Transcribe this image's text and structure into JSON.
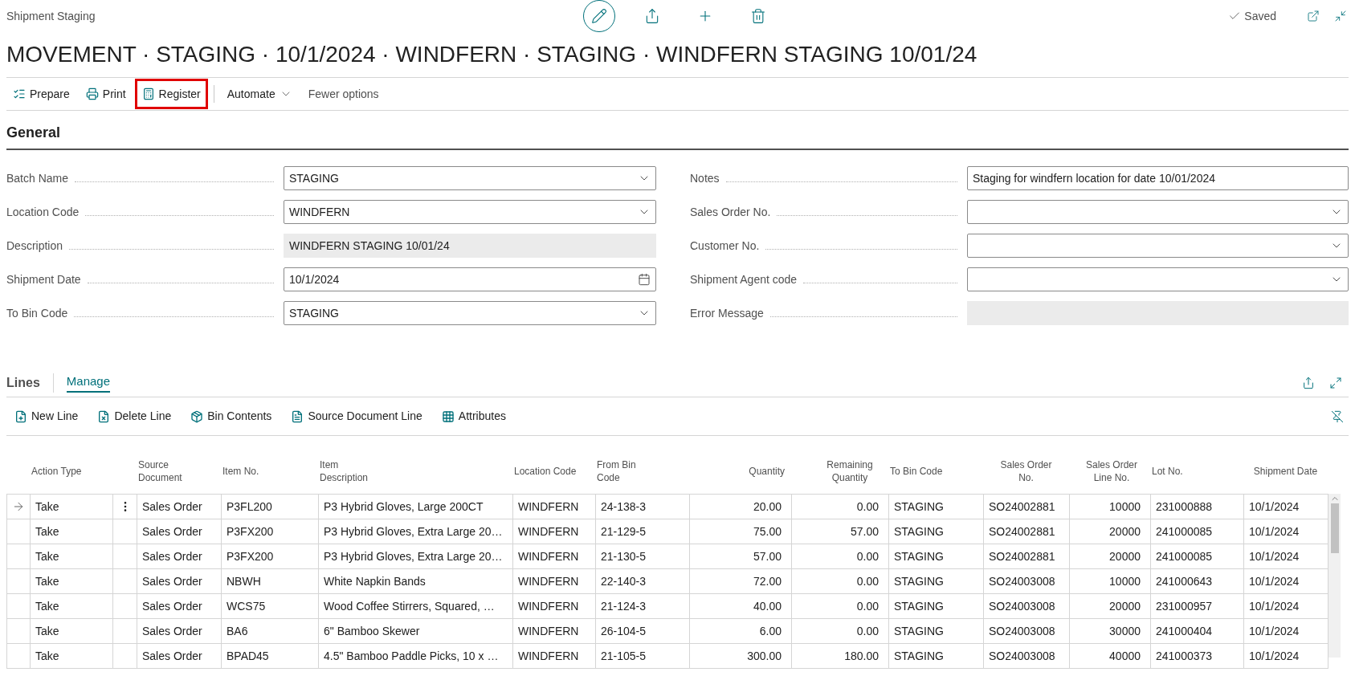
{
  "header": {
    "page_name": "Shipment Staging",
    "status": "Saved",
    "title": "MOVEMENT · STAGING · 10/1/2024 · WINDFERN · STAGING · WINDFERN STAGING 10/01/24"
  },
  "actions": [
    {
      "label": "Prepare",
      "kind": "prepare",
      "highlighted": false
    },
    {
      "label": "Print",
      "kind": "print",
      "highlighted": false
    },
    {
      "label": "Register",
      "kind": "register",
      "highlighted": true
    },
    {
      "label": "Automate",
      "kind": "menu",
      "highlighted": false
    },
    {
      "label": "Fewer options",
      "kind": "plain",
      "highlighted": false
    }
  ],
  "general": {
    "title": "General",
    "left_fields": [
      {
        "label": "Batch Name",
        "value": "STAGING",
        "kind": "dropdown"
      },
      {
        "label": "Location Code",
        "value": "WINDFERN",
        "kind": "dropdown"
      },
      {
        "label": "Description",
        "value": "WINDFERN STAGING 10/01/24",
        "kind": "readonly"
      },
      {
        "label": "Shipment Date",
        "value": "10/1/2024",
        "kind": "date"
      },
      {
        "label": "To Bin Code",
        "value": "STAGING",
        "kind": "dropdown"
      }
    ],
    "right_fields": [
      {
        "label": "Notes",
        "value": "Staging for windfern location for date 10/01/2024",
        "kind": "text"
      },
      {
        "label": "Sales Order No.",
        "kind": "dropdown"
      },
      {
        "label": "Customer No.",
        "kind": "dropdown"
      },
      {
        "label": "Shipment Agent code",
        "kind": "dropdown"
      },
      {
        "label": "Error Message",
        "kind": "readonly"
      }
    ]
  },
  "lines": {
    "title": "Lines",
    "tabs": [
      {
        "label": "Manage",
        "selected": true
      }
    ],
    "actions": [
      {
        "label": "New Line",
        "kind": "new"
      },
      {
        "label": "Delete Line",
        "kind": "delete"
      },
      {
        "label": "Bin Contents",
        "kind": "bin"
      },
      {
        "label": "Source Document Line",
        "kind": "document"
      },
      {
        "label": "Attributes",
        "kind": "grid"
      }
    ],
    "table": {
      "columns": [
        "Action Type",
        "Source Document",
        "Item No.",
        "Item Description",
        "Location Code",
        "From Bin Code",
        "Quantity",
        "Remaining Quantity",
        "To Bin Code",
        "Sales Order No.",
        "Sales Order Line No.",
        "Lot No.",
        "Shipment Date"
      ],
      "rows": [
        {
          "current": true,
          "cells": [
            "Take",
            "Sales Order",
            "P3FL200",
            "P3 Hybrid Gloves, Large 200CT",
            "WINDFERN",
            "24-138-3",
            "20.00",
            "0.00",
            "STAGING",
            "SO24002881",
            "10000",
            "231000888",
            "10/1/2024"
          ]
        },
        {
          "current": false,
          "cells": [
            "Take",
            "Sales Order",
            "P3FX200",
            "P3 Hybrid Gloves, Extra Large 20…",
            "WINDFERN",
            "21-129-5",
            "75.00",
            "57.00",
            "STAGING",
            "SO24002881",
            "20000",
            "241000085",
            "10/1/2024"
          ]
        },
        {
          "current": false,
          "cells": [
            "Take",
            "Sales Order",
            "P3FX200",
            "P3 Hybrid Gloves, Extra Large 20…",
            "WINDFERN",
            "21-130-5",
            "57.00",
            "0.00",
            "STAGING",
            "SO24002881",
            "20000",
            "241000085",
            "10/1/2024"
          ]
        },
        {
          "current": false,
          "cells": [
            "Take",
            "Sales Order",
            "NBWH",
            "White Napkin Bands",
            "WINDFERN",
            "22-140-3",
            "72.00",
            "0.00",
            "STAGING",
            "SO24003008",
            "10000",
            "241000643",
            "10/1/2024"
          ]
        },
        {
          "current": false,
          "cells": [
            "Take",
            "Sales Order",
            "WCS75",
            "Wood Coffee Stirrers, Squared, …",
            "WINDFERN",
            "21-124-3",
            "40.00",
            "0.00",
            "STAGING",
            "SO24003008",
            "20000",
            "231000957",
            "10/1/2024"
          ]
        },
        {
          "current": false,
          "cells": [
            "Take",
            "Sales Order",
            "BA6",
            "6\" Bamboo Skewer",
            "WINDFERN",
            "26-104-5",
            "6.00",
            "0.00",
            "STAGING",
            "SO24003008",
            "30000",
            "241000404",
            "10/1/2024"
          ]
        },
        {
          "current": false,
          "cells": [
            "Take",
            "Sales Order",
            "BPAD45",
            "4.5\" Bamboo Paddle Picks, 10 x …",
            "WINDFERN",
            "21-105-5",
            "300.00",
            "180.00",
            "STAGING",
            "SO24003008",
            "40000",
            "241000373",
            "10/1/2024"
          ]
        }
      ]
    }
  }
}
